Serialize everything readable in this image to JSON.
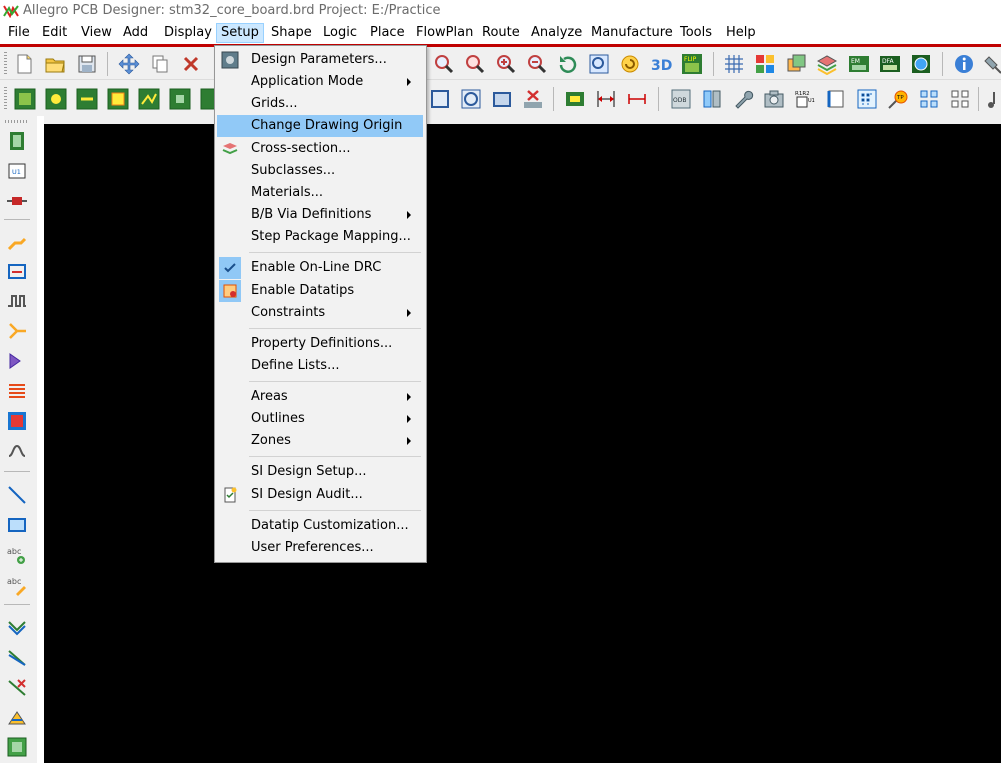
{
  "window": {
    "title": "Allegro PCB Designer: stm32_core_board.brd  Project: E:/Practice"
  },
  "menubar": {
    "items": [
      "File",
      "Edit",
      "View",
      "Add",
      "Display",
      "Setup",
      "Shape",
      "Logic",
      "Place",
      "FlowPlan",
      "Route",
      "Analyze",
      "Manufacture",
      "Tools",
      "Help"
    ],
    "active": "Setup"
  },
  "setup_menu": {
    "items": [
      {
        "label": "Design Parameters...",
        "icon": "design-parameters-icon",
        "submenu": false
      },
      {
        "label": "Application Mode",
        "submenu": true
      },
      {
        "label": "Grids...",
        "submenu": false
      },
      {
        "label": "Change Drawing Origin",
        "submenu": false,
        "highlighted": true
      },
      {
        "label": "Cross-section...",
        "icon": "cross-section-icon",
        "submenu": false
      },
      {
        "label": "Subclasses...",
        "submenu": false
      },
      {
        "label": "Materials...",
        "submenu": false
      },
      {
        "label": "B/B Via Definitions",
        "submenu": true
      },
      {
        "label": "Step Package Mapping...",
        "submenu": false
      },
      {
        "label": "Enable On-Line DRC",
        "checked": true,
        "submenu": false
      },
      {
        "label": "Enable Datatips",
        "icon": "datatips-icon",
        "submenu": false
      },
      {
        "label": "Constraints",
        "submenu": true
      },
      {
        "label": "Property Definitions...",
        "submenu": false
      },
      {
        "label": "Define Lists...",
        "submenu": false
      },
      {
        "label": "Areas",
        "submenu": true
      },
      {
        "label": "Outlines",
        "submenu": true
      },
      {
        "label": "Zones",
        "submenu": true
      },
      {
        "label": "SI Design Setup...",
        "submenu": false
      },
      {
        "label": "SI Design Audit...",
        "icon": "si-audit-icon",
        "submenu": false
      },
      {
        "label": "Datatip Customization...",
        "submenu": false
      },
      {
        "label": "User Preferences...",
        "submenu": false
      }
    ]
  },
  "toolbar_icons_row1": [
    "new-file-icon",
    "open-folder-icon",
    "save-icon",
    "move-icon",
    "copy-icon",
    "delete-icon",
    "zoom-icon",
    "zoom-fit-icon",
    "zoom-in-icon",
    "zoom-out-icon",
    "zoom-previous-icon",
    "zoom-world-icon",
    "redraw-icon",
    "3d-view-icon",
    "flip-board-icon",
    "grid-icon",
    "color-icon",
    "layer-visibility-icon",
    "layers-icon",
    "em-icon",
    "dfa-icon",
    "globe-icon",
    "info-icon",
    "pin-icon"
  ],
  "toolbar_icons_row2": [
    "board-filter-icon",
    "pad-filter-icon",
    "via-filter-icon",
    "shape-filter-icon",
    "cline-filter-icon",
    "dyn-shape-icon",
    "net-icon",
    "rect-shape-icon",
    "circle-shape-icon",
    "frame-icon",
    "clear-shape-icon",
    "keepout-icon",
    "dimension-icon",
    "dimension-linear-icon",
    "odb-icon",
    "swap-icon",
    "wrench-icon",
    "camera-icon",
    "refdes-icon",
    "note-icon",
    "placement-grid-icon",
    "testpoint-icon",
    "matrix-icon",
    "array-icon",
    "music-icon"
  ],
  "left_toolbar_icons": [
    "component-icon",
    "place-u1-icon",
    "resistor-icon",
    "add-connect-icon",
    "slide-icon",
    "delay-tune-icon",
    "fanout-icon",
    "auto-route-icon",
    "bus-route-icon",
    "shape-fill-icon",
    "custom-smooth-icon",
    "add-line-icon",
    "add-rect-icon",
    "add-text-icon",
    "edit-text-icon",
    "route-net-icon",
    "route-diff-icon",
    "delete-route-icon",
    "glossing-icon",
    "grid-shape-icon"
  ],
  "colors": {
    "accent_red": "#c00000",
    "menu_highlight": "#91c9f7",
    "canvas": "#000000"
  }
}
